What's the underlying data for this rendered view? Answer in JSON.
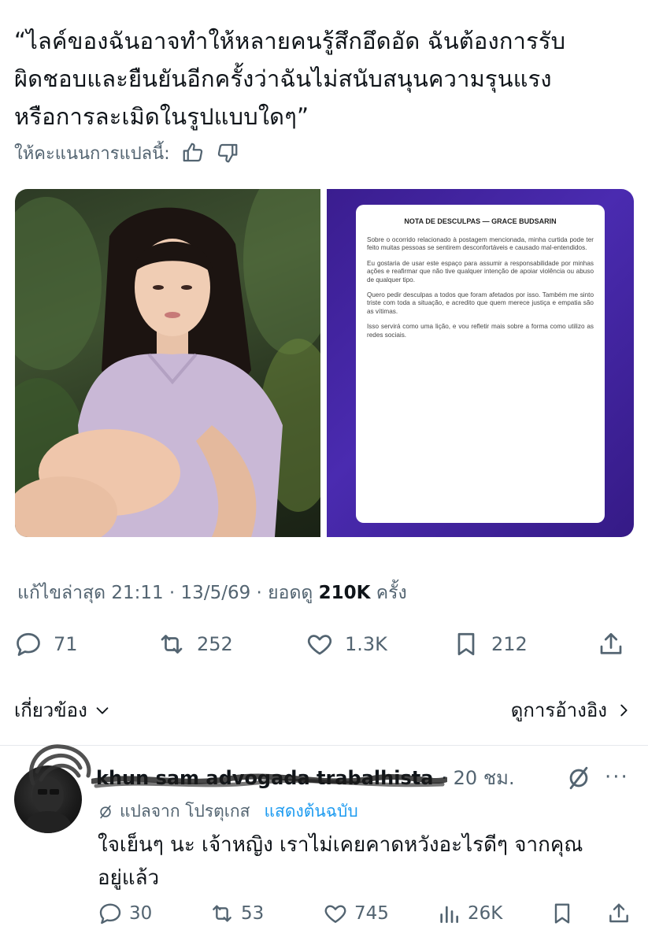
{
  "tweet": {
    "text": "“ไลค์ของฉันอาจทำให้หลายคนรู้สึกอึดอัด ฉันต้องการรับ\nผิดชอบและยืนยันอีกครั้งว่าฉันไม่สนับสนุนความรุนแรง\nหรือการละเมิดในรูปแบบใดๆ”",
    "rate_label": "ให้คะแนนการแปลนี้:",
    "media": {
      "apology": {
        "title": "NOTA DE DESCULPAS — GRACE BUDSARIN",
        "paragraphs": [
          "Sobre o ocorrido relacionado à postagem mencionada, minha curtida pode ter feito muitas pessoas se sentirem desconfortáveis e causado mal-entendidos.",
          "Eu gostaria de usar este espaço para assumir a responsabilidade por minhas ações e reafirmar que não tive qualquer intenção de apoiar violência ou abuso de qualquer tipo.",
          "Quero pedir desculpas a todos que foram afetados por isso. Também me sinto triste com toda a situação, e acredito que quem merece justiça e empatia são as vítimas.",
          "Isso servirá como uma lição, e vou refletir mais sobre a forma como utilizo as redes sociais."
        ]
      }
    },
    "meta": {
      "edited": "แก้ไขล่าสุด 21:11 · 13/5/69",
      "views_prefix": "· ยอดดู",
      "views_count": "210K",
      "views_suffix": "ครั้ง"
    },
    "stats": {
      "replies": "71",
      "reposts": "252",
      "likes": "1.3K",
      "bookmarks": "212"
    },
    "related_label": "เกี่ยวข้อง",
    "quotes_label": "ดูการอ้างอิง"
  },
  "reply": {
    "name": "khun sam advogada trabalhista",
    "time": "· 20 ชม.",
    "translated_from": "แปลจาก โปรตุเกส",
    "show_original": "แสดงต้นฉบับ",
    "text": "ใจเย็นๆ นะ เจ้าหญิง เราไม่เคยคาดหวังอะไรดีๆ จากคุณ\nอยู่แล้ว",
    "stats": {
      "replies": "30",
      "reposts": "53",
      "likes": "745",
      "views": "26K"
    }
  },
  "colors": {
    "text_primary": "#0f1419",
    "text_secondary": "#536471",
    "link_blue": "#1d9bf0",
    "apology_bg": "#4a2bb0"
  }
}
